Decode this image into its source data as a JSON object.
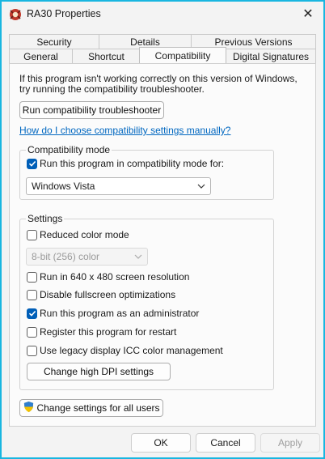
{
  "window": {
    "title": "RA30 Properties",
    "border_color": "#19b6e0",
    "close_glyph": "✕"
  },
  "tabs": {
    "row1": [
      "Security",
      "Details",
      "Previous Versions"
    ],
    "row2": [
      "General",
      "Shortcut",
      "Compatibility",
      "Digital Signatures"
    ],
    "active": "Compatibility"
  },
  "intro_text": "If this program isn't working correctly on this version of Windows, try running the compatibility troubleshooter.",
  "troubleshooter_button": "Run compatibility troubleshooter",
  "help_link": "How do I choose compatibility settings manually?",
  "compat_mode": {
    "legend": "Compatibility mode",
    "checkbox_label": "Run this program in compatibility mode for:",
    "checked": true,
    "selected_os": "Windows Vista"
  },
  "settings": {
    "legend": "Settings",
    "reduced_color": {
      "label": "Reduced color mode",
      "checked": false
    },
    "color_select": "8-bit (256) color",
    "options": [
      {
        "label": "Run in 640 x 480 screen resolution",
        "checked": false
      },
      {
        "label": "Disable fullscreen optimizations",
        "checked": false
      },
      {
        "label": "Run this program as an administrator",
        "checked": true
      },
      {
        "label": "Register this program for restart",
        "checked": false
      },
      {
        "label": "Use legacy display ICC color management",
        "checked": false
      }
    ],
    "dpi_button": "Change high DPI settings"
  },
  "all_users_button": "Change settings for all users",
  "footer": {
    "ok": "OK",
    "cancel": "Cancel",
    "apply": "Apply"
  },
  "colors": {
    "accent": "#005fb8",
    "link": "#0067c0"
  }
}
